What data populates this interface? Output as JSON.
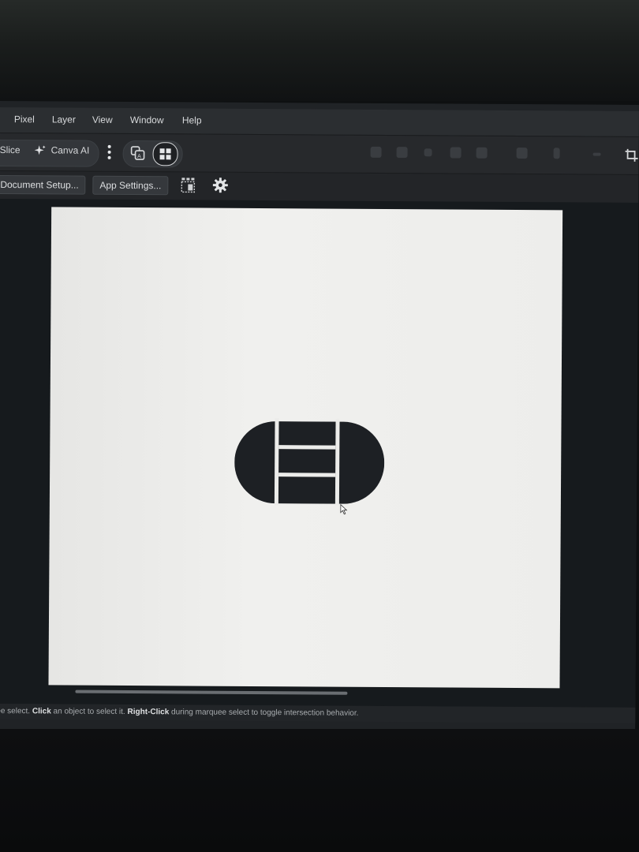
{
  "menu": {
    "items": [
      "Pixel",
      "Layer",
      "View",
      "Window",
      "Help"
    ]
  },
  "toolbar": {
    "slice_label": "Slice",
    "canva_ai_label": "Canva AI"
  },
  "context_bar": {
    "document_setup_label": "Document Setup...",
    "app_settings_label": "App Settings..."
  },
  "status": {
    "prefix": "ee select.",
    "click": "Click",
    "mid": "an object to select it.",
    "right_click": "Right-Click",
    "suffix": "during marquee select to toggle intersection behavior."
  },
  "colors": {
    "artwork": "#1d2024",
    "canvas": "#ececea",
    "ui_dark": "#27292c"
  },
  "icons": {
    "canva_ai": "sparkle-icon",
    "more": "vertical-ellipsis-icon",
    "mode": "frame-grid-icon",
    "settings": "gear-icon",
    "grid_settings": "grid-layout-icon"
  }
}
